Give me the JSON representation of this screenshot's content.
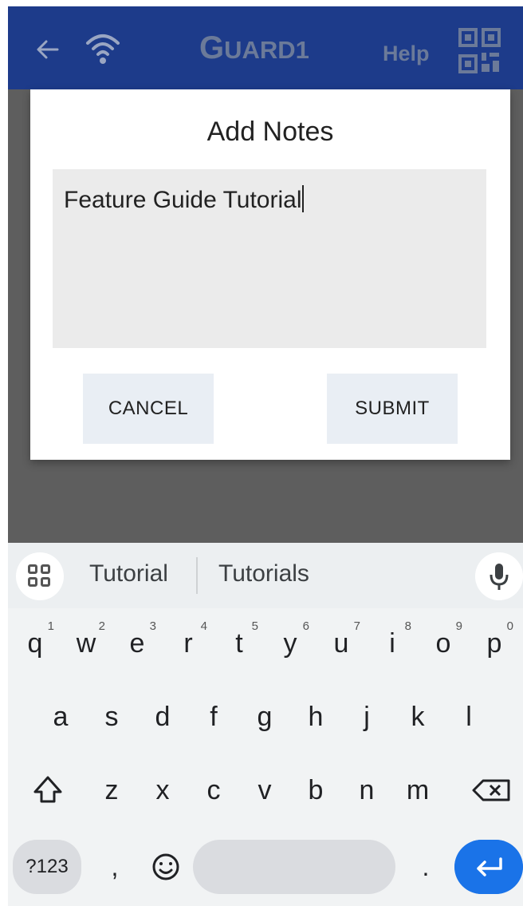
{
  "app_bar": {
    "brand_first": "G",
    "brand_rest": "UARD1",
    "help_label": "Help"
  },
  "dialog": {
    "title": "Add Notes",
    "notes_value": "Feature Guide Tutorial",
    "cancel_label": "CANCEL",
    "submit_label": "SUBMIT"
  },
  "keyboard": {
    "suggestions": [
      "Tutorial",
      "Tutorials"
    ],
    "row1": [
      {
        "key": "q",
        "hint": "1"
      },
      {
        "key": "w",
        "hint": "2"
      },
      {
        "key": "e",
        "hint": "3"
      },
      {
        "key": "r",
        "hint": "4"
      },
      {
        "key": "t",
        "hint": "5"
      },
      {
        "key": "y",
        "hint": "6"
      },
      {
        "key": "u",
        "hint": "7"
      },
      {
        "key": "i",
        "hint": "8"
      },
      {
        "key": "o",
        "hint": "9"
      },
      {
        "key": "p",
        "hint": "0"
      }
    ],
    "row2": [
      "a",
      "s",
      "d",
      "f",
      "g",
      "h",
      "j",
      "k",
      "l"
    ],
    "row3": [
      "z",
      "x",
      "c",
      "v",
      "b",
      "n",
      "m"
    ],
    "symbols_label": "?123",
    "comma": ",",
    "period": "."
  },
  "colors": {
    "app_bar_bg": "#1d3b8a",
    "brand_text": "#6b7a99",
    "enter_key": "#1a73e8",
    "accent_shape": "#5a1008"
  },
  "icons": [
    "back-arrow-icon",
    "wifi-icon",
    "qr-code-icon",
    "apps-grid-icon",
    "microphone-icon",
    "shift-icon",
    "backspace-icon",
    "emoji-icon",
    "enter-icon"
  ]
}
